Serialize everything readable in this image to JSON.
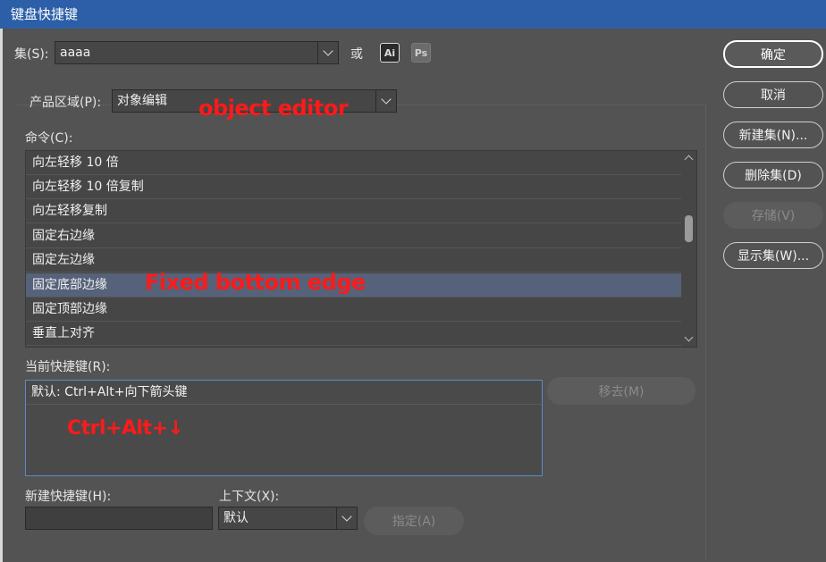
{
  "window": {
    "title": "键盘快捷键"
  },
  "set": {
    "label": "集(S):",
    "value": "aaaa",
    "or_label": "或",
    "app_icons": [
      "Ai",
      "Ps"
    ]
  },
  "area": {
    "label": "产品区域(P):",
    "value": "对象编辑"
  },
  "commands": {
    "label": "命令(C):",
    "items": [
      "向左轻移 10 倍",
      "向左轻移 10 倍复制",
      "向左轻移复制",
      "固定右边缘",
      "固定左边缘",
      "固定底部边缘",
      "固定顶部边缘",
      "垂直上对齐"
    ],
    "selected_index": 5
  },
  "current_shortcuts": {
    "label": "当前快捷键(R):",
    "items": [
      "默认: Ctrl+Alt+向下箭头键"
    ],
    "remove_label": "移去(M)"
  },
  "new_shortcut": {
    "label": "新建快捷键(H):",
    "value": ""
  },
  "context": {
    "label": "上下文(X):",
    "value": "默认"
  },
  "assign_label": "指定(A)",
  "buttons": {
    "ok": "确定",
    "cancel": "取消",
    "new_set": "新建集(N)...",
    "delete_set": "删除集(D)",
    "save": "存储(V)",
    "show_set": "显示集(W)..."
  },
  "annotations": {
    "area": "object editor",
    "command": "Fixed bottom edge",
    "shortcut": "Ctrl+Alt+↓"
  },
  "colors": {
    "titlebar": "#2c5fa8",
    "background": "#535353",
    "selection": "#56627a",
    "annotation": "#ff1a1a",
    "focus_border": "#5b8bc8"
  }
}
